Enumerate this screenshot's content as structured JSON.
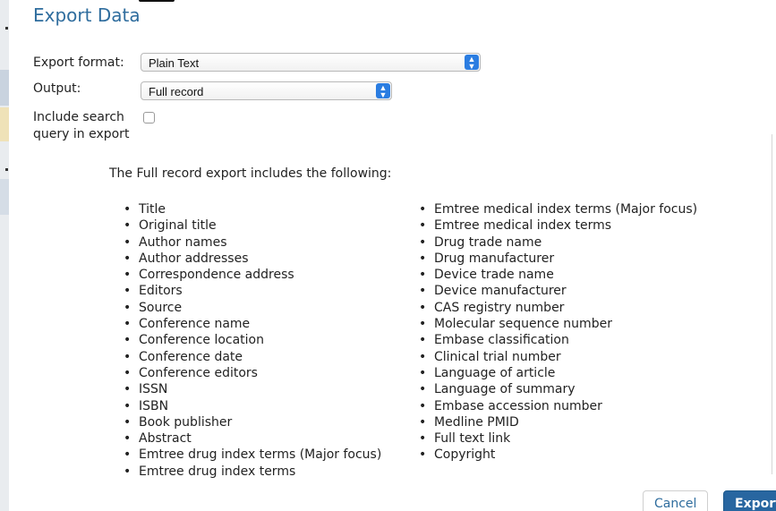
{
  "dialog": {
    "title": "Export Data"
  },
  "form": {
    "export_format_label": "Export format:",
    "export_format_value": "Plain Text",
    "output_label": "Output:",
    "output_value": "Full record",
    "include_query_label_line1": "Include search",
    "include_query_label_line2": "query in export",
    "include_query_checked": false
  },
  "description": {
    "intro": "The Full record export includes the following:",
    "left_items": [
      "Title",
      "Original title",
      "Author names",
      "Author addresses",
      "Correspondence address",
      "Editors",
      "Source",
      "Conference name",
      "Conference location",
      "Conference date",
      "Conference editors",
      "ISSN",
      "ISBN",
      "Book publisher",
      "Abstract",
      "Emtree drug index terms (Major focus)",
      "Emtree drug index terms"
    ],
    "right_items": [
      "Emtree medical index terms (Major focus)",
      "Emtree medical index terms",
      "Drug trade name",
      "Drug manufacturer",
      "Device trade name",
      "Device manufacturer",
      "CAS registry number",
      "Molecular sequence number",
      "Embase classification",
      "Clinical trial number",
      "Language of article",
      "Language of summary",
      "Embase accession number",
      "Medline PMID",
      "Full text link",
      "Copyright"
    ]
  },
  "buttons": {
    "cancel_label": "Cancel",
    "export_label": "Export"
  },
  "colors": {
    "title": "#2f6d9e",
    "select_arrow": "#2b7de1",
    "primary_button": "#2866a0"
  }
}
